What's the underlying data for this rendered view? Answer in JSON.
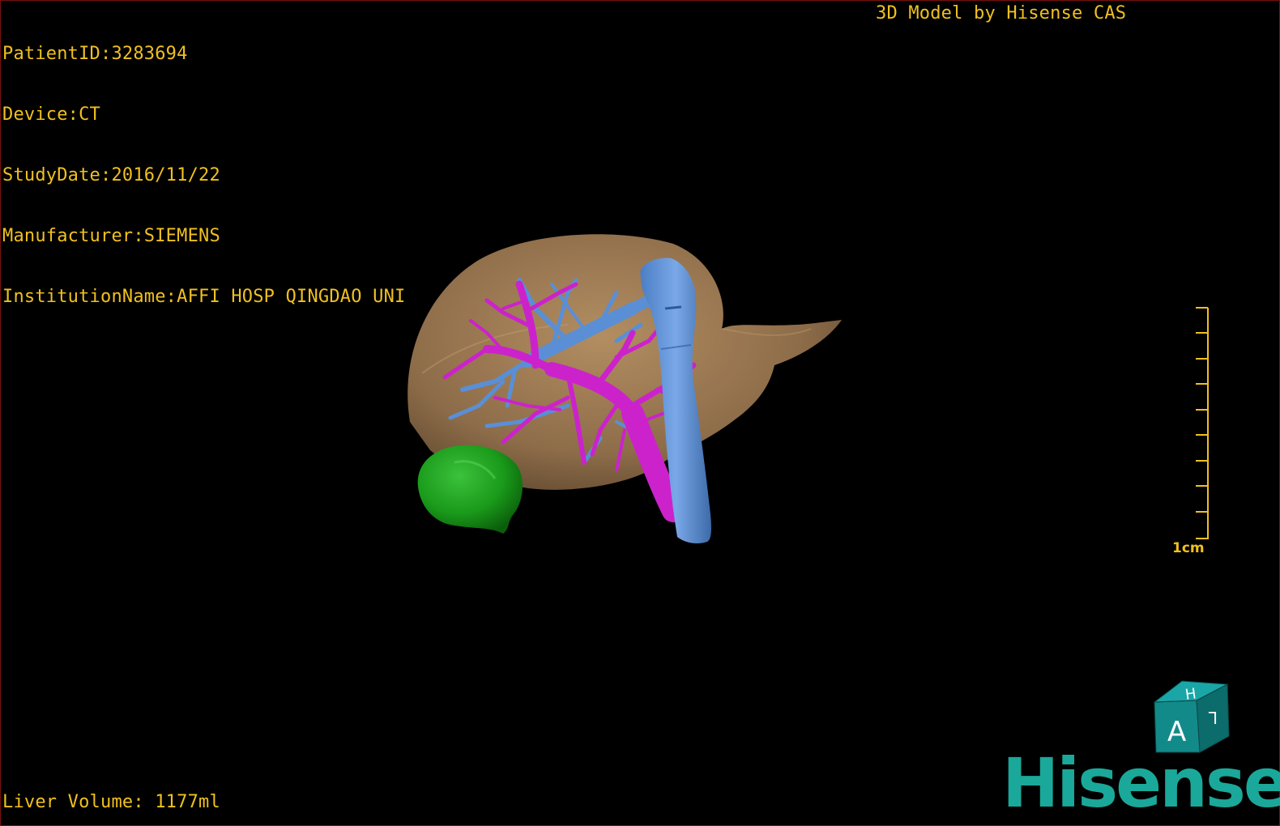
{
  "info": {
    "patient_id": "PatientID:3283694",
    "device": "Device:CT",
    "study_date": "StudyDate:2016/11/22",
    "manufacturer": "Manufacturer:SIEMENS",
    "institution": "InstitutionName:AFFI HOSP QINGDAO UNI"
  },
  "credit": "3D Model by Hisense CAS",
  "liver_volume": "Liver Volume: 1177ml",
  "scale": {
    "label": "1cm"
  },
  "orientation_cube": {
    "face_front": "A",
    "face_top": "H",
    "face_side": "L"
  },
  "brand": "Hisense",
  "colors": {
    "overlay_text": "#f0c020",
    "liver": "#b08a5c",
    "portal_vein": "#cc22cc",
    "hepatic_vein_ivc": "#5a8fd6",
    "gallbladder": "#1e9a1e",
    "brand": "#1aa89a",
    "cube": "#138a8a",
    "frame_border": "#7a1010"
  }
}
